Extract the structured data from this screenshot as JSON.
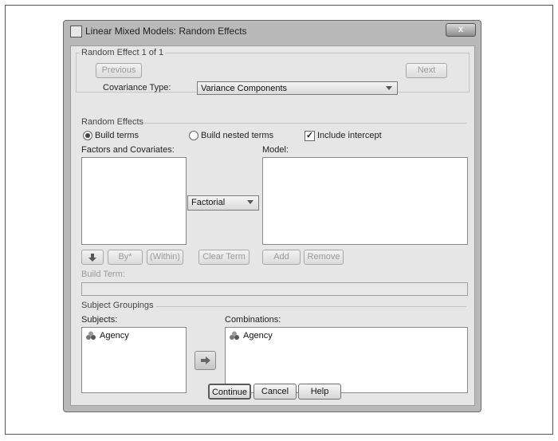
{
  "window": {
    "title": "Linear Mixed Models: Random Effects",
    "close_glyph": "x"
  },
  "random_effect_section": {
    "legend": "Random Effect 1 of 1",
    "previous_label": "Previous",
    "next_label": "Next",
    "covariance_label": "Covariance Type:",
    "covariance_value": "Variance Components"
  },
  "random_effects_section": {
    "legend": "Random Effects",
    "build_terms_label": "Build terms",
    "build_terms_selected": true,
    "build_nested_label": "Build nested terms",
    "build_nested_selected": false,
    "include_intercept_label": "Include intercept",
    "include_intercept_checked": true,
    "factors_label": "Factors and Covariates:",
    "model_label": "Model:",
    "term_type_value": "Factorial",
    "by_label": "By*",
    "within_label": "(Within)",
    "clear_term_label": "Clear Term",
    "add_label": "Add",
    "remove_label": "Remove",
    "build_term_label": "Build Term:"
  },
  "subject_groupings_section": {
    "legend": "Subject Groupings",
    "subjects_label": "Subjects:",
    "combinations_label": "Combinations:",
    "subjects": [
      "Agency"
    ],
    "combinations": [
      "Agency"
    ]
  },
  "footer": {
    "continue_label": "Continue",
    "cancel_label": "Cancel",
    "help_label": "Help"
  }
}
